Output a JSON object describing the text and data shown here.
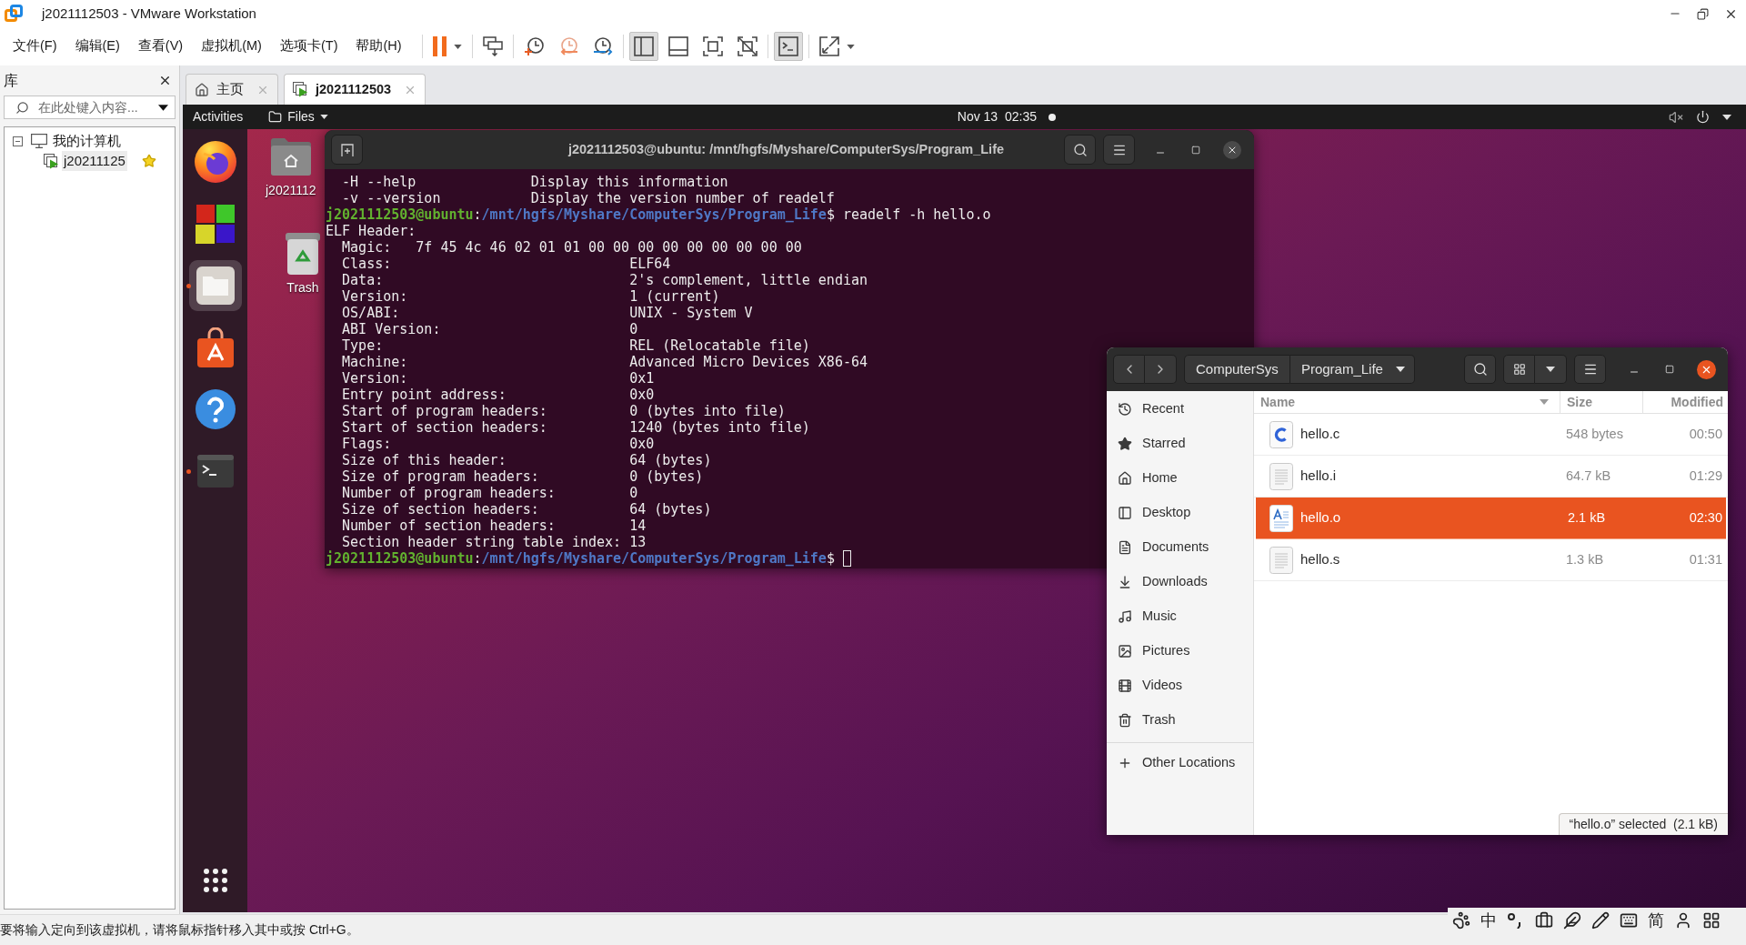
{
  "window": {
    "title": "j2021112503 - VMware Workstation"
  },
  "menu": [
    "文件(F)",
    "编辑(E)",
    "查看(V)",
    "虚拟机(M)",
    "选项卡(T)",
    "帮助(H)"
  ],
  "toolbar": [
    {
      "items": [
        {
          "kind": "pause",
          "pressed": false
        }
      ]
    },
    {
      "items": [
        {
          "kind": "sendkeys",
          "pressed": false
        }
      ]
    },
    {
      "items": [
        {
          "kind": "snapshot",
          "pressed": false
        },
        {
          "kind": "revert",
          "pressed": false
        },
        {
          "kind": "manager",
          "pressed": false
        }
      ]
    },
    {
      "items": [
        {
          "kind": "library",
          "pressed": true
        },
        {
          "kind": "thumbnails",
          "pressed": false
        },
        {
          "kind": "fullscreen",
          "pressed": false
        },
        {
          "kind": "unity",
          "pressed": false
        }
      ]
    },
    {
      "items": [
        {
          "kind": "console",
          "pressed": true
        }
      ]
    },
    {
      "items": [
        {
          "kind": "stretch",
          "pressed": false
        }
      ]
    }
  ],
  "library": {
    "title": "库",
    "search": {
      "placeholder": "在此处键入内容..."
    },
    "tree": [
      {
        "label": "我的计算机",
        "expanded": true,
        "children": [
          {
            "label": "j20211125",
            "selected": true,
            "favorite": true
          }
        ]
      }
    ]
  },
  "tabs": [
    {
      "kind": "home",
      "label": "主页",
      "selected": false
    },
    {
      "kind": "vm",
      "label": "j2021112503",
      "selected": true
    }
  ],
  "guest": {
    "top_bar": {
      "activities": "Activities",
      "app_menu": "Files",
      "clock": "Nov 13  02:35",
      "notification": true,
      "muted": true
    },
    "dock": [
      {
        "kind": "browser",
        "running": false,
        "focused": false
      },
      {
        "kind": "cubes",
        "running": false,
        "focused": false
      },
      {
        "kind": "files",
        "running": true,
        "focused": true
      },
      {
        "kind": "software",
        "running": false,
        "focused": false
      },
      {
        "kind": "help",
        "running": false,
        "focused": false
      },
      {
        "kind": "terminal",
        "running": true,
        "focused": false
      }
    ],
    "desktop_icons": [
      {
        "kind": "home",
        "label": "j2021112"
      },
      {
        "kind": "trash",
        "label": "Trash"
      }
    ],
    "terminal": {
      "title": "j2021112503@ubuntu: /mnt/hgfs/Myshare/ComputerSys/Program_Life",
      "lines": [
        {
          "kind": "option",
          "flag": "-H --help",
          "description": "Display this information"
        },
        {
          "kind": "option",
          "flag": "-v --version",
          "description": "Display the version number of readelf"
        },
        {
          "kind": "prompt",
          "user": "j2021112503@ubuntu",
          "sep": ":",
          "path": "/mnt/hgfs/Myshare/ComputerSys/Program_Life",
          "sign": "$",
          "command": "readelf -h hello.o",
          "cursor": false
        },
        {
          "kind": "heading",
          "text": "ELF Header:"
        },
        {
          "kind": "indented",
          "text": "Magic:   7f 45 4c 46 02 01 01 00 00 00 00 00 00 00 00 00"
        },
        {
          "kind": "field",
          "label": "Class:",
          "value": "ELF64"
        },
        {
          "kind": "field",
          "label": "Data:",
          "value": "2's complement, little endian"
        },
        {
          "kind": "field",
          "label": "Version:",
          "value": "1 (current)"
        },
        {
          "kind": "field",
          "label": "OS/ABI:",
          "value": "UNIX - System V"
        },
        {
          "kind": "field",
          "label": "ABI Version:",
          "value": "0"
        },
        {
          "kind": "field",
          "label": "Type:",
          "value": "REL (Relocatable file)"
        },
        {
          "kind": "field",
          "label": "Machine:",
          "value": "Advanced Micro Devices X86-64"
        },
        {
          "kind": "field",
          "label": "Version:",
          "value": "0x1"
        },
        {
          "kind": "field",
          "label": "Entry point address:",
          "value": "0x0"
        },
        {
          "kind": "field",
          "label": "Start of program headers:",
          "value": "0 (bytes into file)"
        },
        {
          "kind": "field",
          "label": "Start of section headers:",
          "value": "1240 (bytes into file)"
        },
        {
          "kind": "field",
          "label": "Flags:",
          "value": "0x0"
        },
        {
          "kind": "field",
          "label": "Size of this header:",
          "value": "64 (bytes)"
        },
        {
          "kind": "field",
          "label": "Size of program headers:",
          "value": "0 (bytes)"
        },
        {
          "kind": "field",
          "label": "Number of program headers:",
          "value": "0"
        },
        {
          "kind": "field",
          "label": "Size of section headers:",
          "value": "64 (bytes)"
        },
        {
          "kind": "field",
          "label": "Number of section headers:",
          "value": "14"
        },
        {
          "kind": "field",
          "label": "Section header string table index:",
          "value": "13"
        },
        {
          "kind": "prompt",
          "user": "j2021112503@ubuntu",
          "sep": ":",
          "path": "/mnt/hgfs/Myshare/ComputerSys/Program_Life",
          "sign": "$",
          "cursor": true
        }
      ]
    },
    "files": {
      "path": [
        "ComputerSys",
        "Program_Life"
      ],
      "sidebar": [
        {
          "kind": "recent",
          "label": "Recent"
        },
        {
          "kind": "starred",
          "label": "Starred"
        },
        {
          "kind": "home",
          "label": "Home"
        },
        {
          "kind": "desktop",
          "label": "Desktop"
        },
        {
          "kind": "documents",
          "label": "Documents"
        },
        {
          "kind": "downloads",
          "label": "Downloads"
        },
        {
          "kind": "music",
          "label": "Music"
        },
        {
          "kind": "pictures",
          "label": "Pictures"
        },
        {
          "kind": "videos",
          "label": "Videos"
        },
        {
          "kind": "trash",
          "label": "Trash"
        },
        {
          "kind": "other",
          "label": "Other Locations"
        }
      ],
      "columns": [
        {
          "label": "Name",
          "sorted": true
        },
        {
          "label": "Size",
          "sorted": false
        },
        {
          "label": "Modified",
          "sorted": false
        }
      ],
      "rows": [
        {
          "kind": "csource",
          "name": "hello.c",
          "size": "548 bytes",
          "modified": "00:50",
          "selected": false
        },
        {
          "kind": "plain",
          "name": "hello.i",
          "size": "64.7 kB",
          "modified": "01:29",
          "selected": false
        },
        {
          "kind": "richtext",
          "name": "hello.o",
          "size": "2.1 kB",
          "modified": "02:30",
          "selected": true
        },
        {
          "kind": "plain",
          "name": "hello.s",
          "size": "1.3 kB",
          "modified": "01:31",
          "selected": false
        }
      ],
      "status": "“hello.o” selected  (2.1 kB)"
    }
  },
  "status_bar": {
    "text": "要将输入定向到该虚拟机，请将鼠标指针移入其中或按 Ctrl+G。"
  },
  "ime_bar": {
    "mode": "中",
    "charset": "简"
  }
}
